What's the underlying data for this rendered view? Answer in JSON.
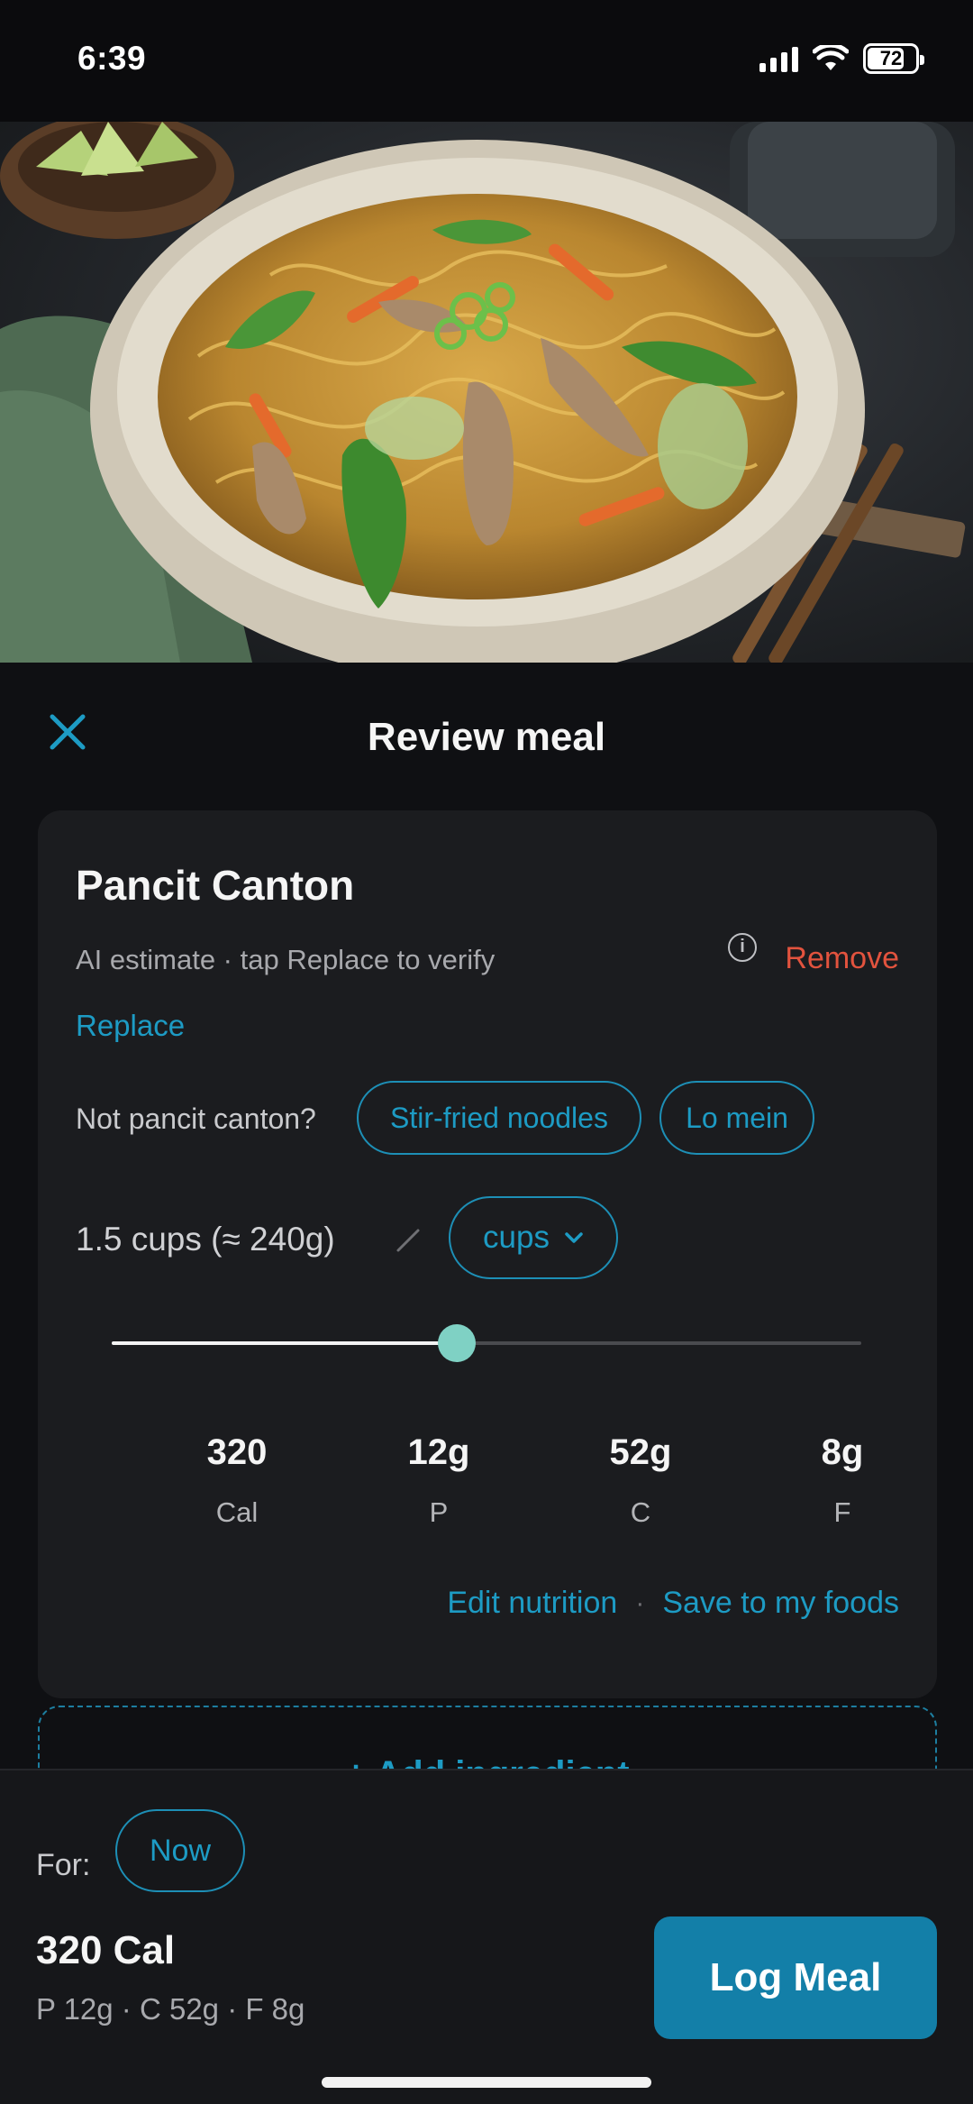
{
  "status_bar": {
    "time": "6:39",
    "battery": "72"
  },
  "hero": {
    "image_description_icon": "food-photo-pancit-canton"
  },
  "header": {
    "title": "Review meal",
    "close_icon": "close-icon"
  },
  "item": {
    "name": "Pancit Canton",
    "estimate_note": "AI estimate · tap Replace to verify",
    "remove_label": "Remove",
    "replace_label": "Replace",
    "not_label": "Not pancit canton?",
    "suggestions": [
      "Stir-fried noodles",
      "Lo mein"
    ],
    "portion_text": "1.5 cups (≈ 240g)",
    "unit_value": "cups",
    "slider_fraction": 0.46,
    "macros": [
      {
        "value": "320",
        "label": "Cal"
      },
      {
        "value": "12g",
        "label": "P"
      },
      {
        "value": "52g",
        "label": "C"
      },
      {
        "value": "8g",
        "label": "F"
      }
    ],
    "edit_nutrition_label": "Edit nutrition",
    "separator": "·",
    "save_label": "Save to my foods"
  },
  "add_ingredient_label": "+ Add ingredient",
  "footer": {
    "for_label": "For:",
    "for_value": "Now",
    "total_cal": "320 Cal",
    "total_macros": "P 12g · C 52g · F 8g",
    "log_button": "Log Meal"
  },
  "colors": {
    "accent": "#1d9bc4",
    "danger": "#e2533e",
    "button": "#137fa8",
    "slider_thumb": "#7fd1c4"
  }
}
